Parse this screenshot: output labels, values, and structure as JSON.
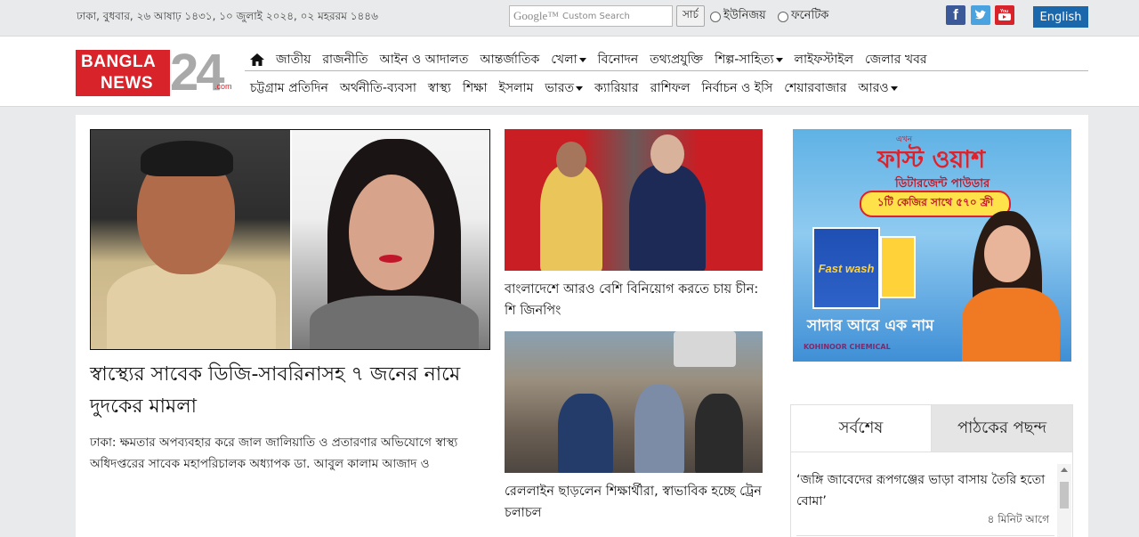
{
  "topbar": {
    "date": "ঢাকা, বুধবার, ২৬ আষাঢ় ১৪৩১, ১০ জুলাই ২০২৪, ০২ মহররম ১৪৪৬",
    "search_logo": "Google™",
    "search_placeholder": "Custom Search",
    "search_button": "সার্চ",
    "radio_unijoy": "ইউনিজয়",
    "radio_phonetic": "ফনেটিক",
    "english_button": "English",
    "colors": {
      "facebook": "#3b5998",
      "twitter": "#4aa3df",
      "youtube": "#d9232a",
      "english": "#1a67ac"
    }
  },
  "logo": {
    "line1": "BANGLA",
    "line2": "NEWS",
    "number": "24",
    "domain": ".com"
  },
  "nav": {
    "row1": [
      "জাতীয়",
      "রাজনীতি",
      "আইন ও আদালত",
      "আন্তর্জাতিক",
      "খেলা",
      "বিনোদন",
      "তথ্যপ্রযুক্তি",
      "শিল্প-সাহিত্য",
      "লাইফস্টাইল",
      "জেলার খবর"
    ],
    "row2": [
      "চট্টগ্রাম প্রতিদিন",
      "অর্থনীতি-ব্যবসা",
      "স্বাস্থ্য",
      "শিক্ষা",
      "ইসলাম",
      "ভারত",
      "ক্যারিয়ার",
      "রাশিফল",
      "নির্বাচন ও ইসি",
      "শেয়ারবাজার",
      "আরও"
    ]
  },
  "lead": {
    "title": "স্বাস্থ্যের সাবেক ডিজি-সাবরিনাসহ ৭ জনের নামে দুদকের মামলা",
    "summary": "ঢাকা: ক্ষমতার অপব্যবহার করে জাল জালিয়াতি ও প্রতারণার অভিযোগে স্বাস্থ্য অধিদপ্তরের সাবেক মহাপরিচালক অধ্যাপক ডা. আবুল কালাম আজাদ ও"
  },
  "middle": [
    {
      "title": "বাংলাদেশে আরও বেশি বিনিয়োগ করতে চায় চীন: শি জিনপিং"
    },
    {
      "title": "রেললাইন ছাড়লেন শিক্ষার্থীরা, স্বাভাবিক হচ্ছে ট্রেন চলাচল"
    }
  ],
  "ad": {
    "top": "এখন",
    "title": "ফাস্ট ওয়াশ",
    "subtitle": "ডিটারজেন্ট পাউডার",
    "offer": "১টি কেজির সাথে ৫৭০ ফ্রী",
    "pack": "Fast wash",
    "slogan": "সাদার আরে এক নাম",
    "brand": "KOHINOOR CHEMICAL"
  },
  "tabs": {
    "latest": "সর্বশেষ",
    "popular": "পাঠকের পছন্দ"
  },
  "latest": [
    {
      "title": "‘জঙ্গি জাবেদের রূপগঞ্জের ভাড়া বাসায় তৈরি হতো বোমা’",
      "time": "৪ মিনিট আগে"
    }
  ]
}
